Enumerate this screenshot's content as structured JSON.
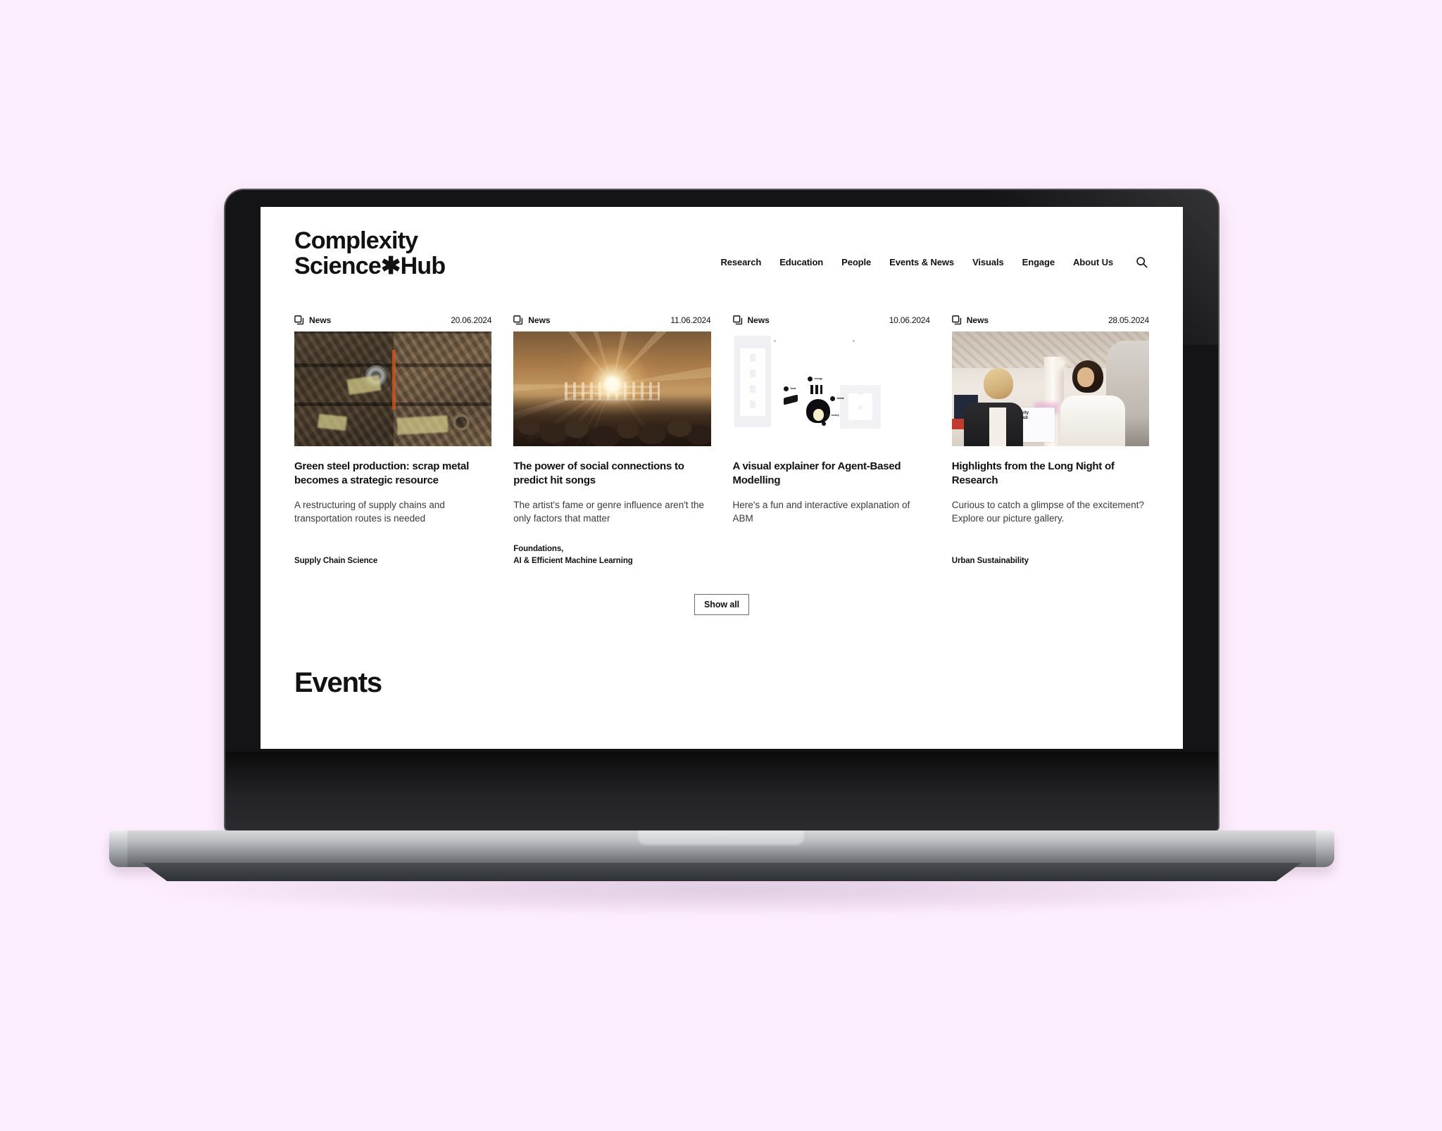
{
  "page": {
    "background_color": "#fdeefe",
    "device": "laptop-mockup"
  },
  "site": {
    "logo": {
      "line1": "Complexity",
      "line2": "Science✱Hub",
      "full": "Complexity\nScience✱Hub"
    },
    "nav": {
      "items": [
        {
          "label": "Research"
        },
        {
          "label": "Education"
        },
        {
          "label": "People"
        },
        {
          "label": "Events & News"
        },
        {
          "label": "Visuals"
        },
        {
          "label": "Engage"
        },
        {
          "label": "About Us"
        }
      ],
      "search_icon": "search-icon"
    },
    "cards": [
      {
        "kind": "News",
        "kind_icon": "copy-icon",
        "date": "20.06.2024",
        "title": "Green steel production: scrap metal becomes a strategic resource",
        "description": "A restructuring of supply chains and transportation routes is needed",
        "tags": [
          "Supply Chain Science"
        ],
        "media": "scrap-metal-bales-photo"
      },
      {
        "kind": "News",
        "kind_icon": "copy-icon",
        "date": "11.06.2024",
        "title": "The power of social connections to predict hit songs",
        "description": "The artist's fame or genre influence aren't the only factors that matter",
        "tags": [
          "Foundations,",
          "AI & Efficient Machine Learning"
        ],
        "media": "concert-crowd-photo"
      },
      {
        "kind": "News",
        "kind_icon": "copy-icon",
        "date": "10.06.2024",
        "title": "A visual explainer for Agent-Based Modelling",
        "description": "Here's a fun and interactive explanation of ABM",
        "tags": [],
        "media": "agent-based-modelling-illustration"
      },
      {
        "kind": "News",
        "kind_icon": "copy-icon",
        "date": "28.05.2024",
        "title": "Highlights from the Long Night of Research",
        "description": "Curious to catch a glimpse of the excitement? Explore our picture gallery.",
        "tags": [
          "Urban Sustainability"
        ],
        "media": "event-conversation-photo"
      }
    ],
    "show_all_label": "Show all",
    "events_section": {
      "title": "Events"
    },
    "illustration_labels": {
      "energy": "energy",
      "food": "food",
      "habits": "habits",
      "money": "money"
    },
    "event_photo_banner": "omplexity\nnce✱Hub"
  }
}
